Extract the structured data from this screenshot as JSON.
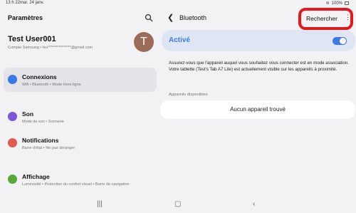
{
  "status": {
    "time": "13 h 22",
    "date": "mar. 24 janv.",
    "battery": "100%"
  },
  "left": {
    "title": "Paramètres",
    "account": {
      "name": "Test User001",
      "sub": "Compte Samsung  •  tes***************@gmail.com",
      "avatar_letter": "T"
    },
    "menu": [
      {
        "label": "Connexions",
        "desc": "Wifi  •  Bluetooth  •  Mode Hors-ligne",
        "icon": "wifi-icon",
        "color": "#3a78e6"
      },
      {
        "label": "Son",
        "desc": "Mode de son  •  Sonnerie",
        "icon": "volume-icon",
        "color": "#7d55d8"
      },
      {
        "label": "Notifications",
        "desc": "Barre d'état  •  Ne pas déranger",
        "icon": "notification-icon",
        "color": "#e05a4d"
      },
      {
        "label": "Affichage",
        "desc": "Luminosité  •  Protection du confort visuel  •  Barre de navigation",
        "icon": "brightness-icon",
        "color": "#57a93b"
      }
    ]
  },
  "right": {
    "title": "Bluetooth",
    "search_label": "Rechercher",
    "toggle_label": "Activé",
    "info": "Assurez-vous que l'appareil auquel vous souhaitez vous connecter est en mode association. Votre tablette (Test's Tab A7 Lite) est actuellement visible sur les appareils à proximité.",
    "section": "Appareils disponibles",
    "no_device": "Aucun appareil trouvé"
  },
  "colors": {
    "accent": "#3e79e4",
    "highlight": "#e3191c"
  }
}
